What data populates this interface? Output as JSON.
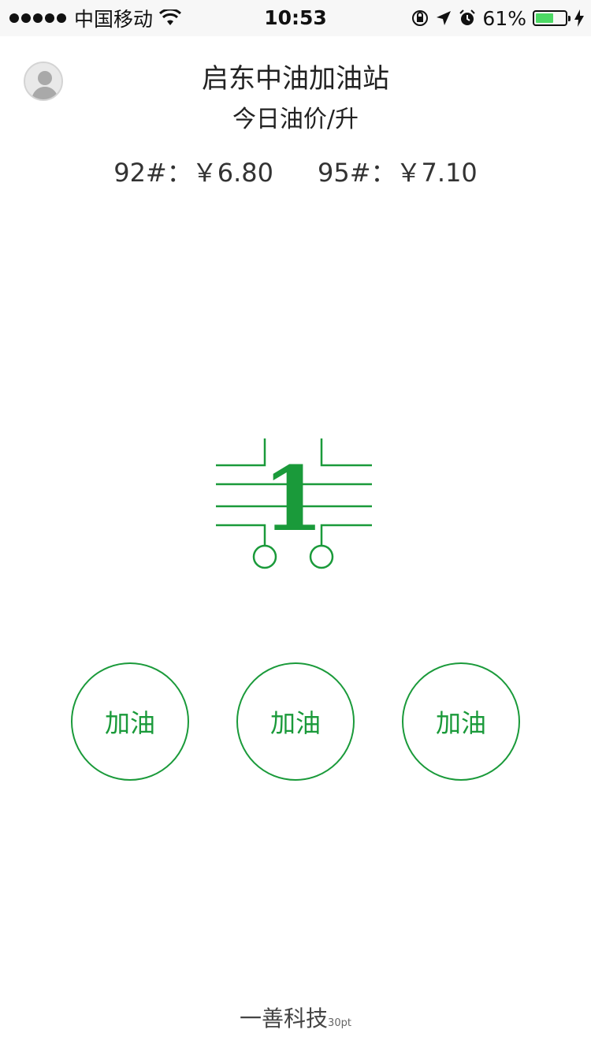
{
  "status_bar": {
    "carrier": "中国移动",
    "time": "10:53",
    "battery_percent": "61%",
    "battery_level": 0.61,
    "icons": [
      "signal-dots-icon",
      "wifi-icon",
      "orientation-lock-icon",
      "location-arrow-icon",
      "alarm-icon",
      "battery-icon",
      "charging-bolt-icon"
    ]
  },
  "header": {
    "station_name": "启东中油加油站",
    "price_title": "今日油价/升",
    "prices": [
      {
        "label": "92#：￥6.80"
      },
      {
        "label": "95#：￥7.10"
      }
    ]
  },
  "logo": {
    "digit": "1",
    "color": "#1a9a3a"
  },
  "buttons": [
    {
      "label": "加油"
    },
    {
      "label": "加油"
    },
    {
      "label": "加油"
    }
  ],
  "footer": {
    "brand": "一善科技",
    "note": "30pt"
  },
  "colors": {
    "accent": "#1a9a3a",
    "status_bar_bg": "#f7f7f7",
    "battery_fill": "#4cd964"
  }
}
